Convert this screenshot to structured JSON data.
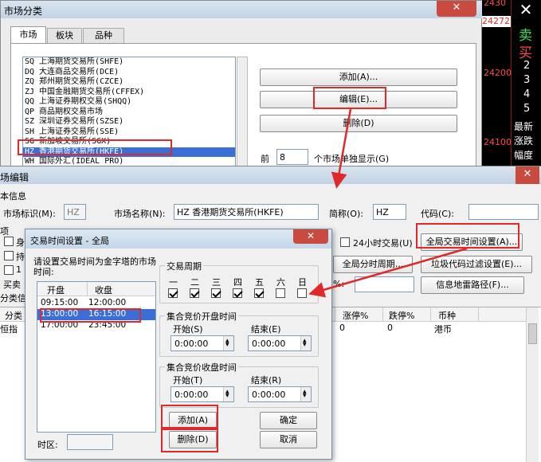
{
  "market_dialog": {
    "title": "市场分类",
    "tabs": [
      "市场",
      "板块",
      "品种"
    ],
    "markets": [
      "SQ 上海期货交易所(SHFE)",
      "DQ 大连商品交易所(DCE)",
      "ZQ 郑州期货交易所(CZCE)",
      "ZJ 中国金融期货交易所(CFFEX)",
      "QQ 上海证券期权交易(SHQQ)",
      "QP 商品期权交易市场",
      "SZ 深圳证券交易所(SZSE)",
      "SH 上海证券交易所(SSE)",
      "SG 新加坡交易所(SGX)",
      "HZ 香港期货交易所(HKFE)",
      "WH 国际外汇(IDEAL PRO)"
    ],
    "selected_index": 9,
    "add_button": "添加(A)...",
    "edit_button": "编辑(E)...",
    "delete_button": "删除(D)",
    "show_prefix": "前",
    "show_count": "8",
    "show_suffix": "个市场单独显示(G)"
  },
  "price_panel": {
    "prices": [
      "2430",
      "24272",
      "24200",
      "24100"
    ],
    "buy_label": "卖",
    "sell_label": "买",
    "levels": [
      "2",
      "3",
      "4",
      "5"
    ],
    "menu": [
      "最新",
      "涨跌",
      "幅度"
    ]
  },
  "edit_dialog": {
    "title": "场编辑",
    "section_basic": "本信息",
    "market_id_label": "市场标识(M):",
    "market_id_value": "HZ",
    "market_name_label": "市场名称(N):",
    "market_name_value": "HZ 香港期货交易所(HKFE)",
    "short_label": "简称(O):",
    "short_value": "HZ",
    "code_label": "代码(C):",
    "code_value": "",
    "options_label": "项",
    "left_checks": [
      "身",
      "持",
      "1"
    ],
    "buy_sell_label": "买卖",
    "class_info_label": "分类信",
    "h24_label": "24小时交易(U)",
    "global_time_button": "全局交易时间设置(A)...",
    "global_minute_button": "全局分时周期...",
    "junk_filter_button": "垃圾代码过滤设置(E)...",
    "info_path_button": "信息地雷路径(F)...",
    "table": {
      "headers": [
        "分类",
        "涨停%",
        "跌停%",
        "币种"
      ],
      "row": {
        "name": "恒指",
        "up": "0",
        "down": "0",
        "currency": "港币"
      }
    }
  },
  "time_dialog": {
    "title": "交易时间设置 - 全局",
    "instruction": "请设置交易时间为金字塔的市场时间:",
    "col_open": "开盘",
    "col_close": "收盘",
    "sessions": [
      {
        "open": "09:15:00",
        "close": "12:00:00"
      },
      {
        "open": "13:00:00",
        "close": "16:15:00"
      },
      {
        "open": "17:00:00",
        "close": "23:45:00"
      }
    ],
    "timezone_label": "时区:",
    "period_title": "交易周期",
    "weekdays": [
      "一",
      "二",
      "三",
      "四",
      "五",
      "六",
      "日"
    ],
    "weekday_checked": [
      true,
      true,
      true,
      true,
      true,
      false,
      false
    ],
    "open_auction_title": "集合竞价开盘时间",
    "close_auction_title": "集合竞价收盘时间",
    "start_label": "开始(S)",
    "end_label": "结束(E)",
    "start_label2": "开始(T)",
    "end_label2": "结束(R)",
    "time_zero": "0:00:00",
    "add_button": "添加(A)",
    "delete_button": "删除(D)",
    "ok_button": "确定",
    "cancel_button": "取消"
  }
}
